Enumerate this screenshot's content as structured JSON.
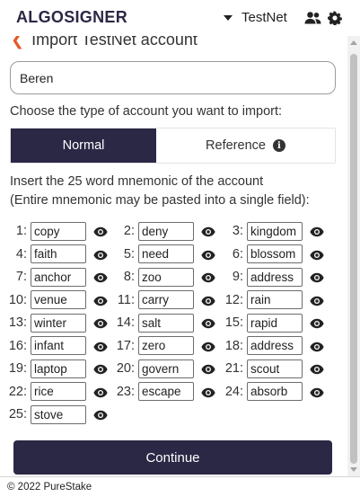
{
  "header": {
    "logo_text": "ALGOSIGNER",
    "network": "TestNet",
    "accounts_icon": "users-icon",
    "settings_icon": "gear-icon"
  },
  "page": {
    "back_icon": "chevron-left-icon",
    "title": "Import TestNet account"
  },
  "form": {
    "account_name_value": "Beren",
    "choose_label": "Choose the type of account you want to import:",
    "types": [
      {
        "label": "Normal",
        "selected": true
      },
      {
        "label": "Reference",
        "selected": false,
        "icon": "info-icon"
      }
    ],
    "instruction_line1": "Insert the 25 word mnemonic of the account",
    "instruction_line2": "(Entire mnemonic may be pasted into a single field):",
    "mnemonic": [
      {
        "n": "1:",
        "w": "copy"
      },
      {
        "n": "2:",
        "w": "deny"
      },
      {
        "n": "3:",
        "w": "kingdom"
      },
      {
        "n": "4:",
        "w": "faith"
      },
      {
        "n": "5:",
        "w": "need"
      },
      {
        "n": "6:",
        "w": "blossom"
      },
      {
        "n": "7:",
        "w": "anchor"
      },
      {
        "n": "8:",
        "w": "zoo"
      },
      {
        "n": "9:",
        "w": "address"
      },
      {
        "n": "10:",
        "w": "venue"
      },
      {
        "n": "11:",
        "w": "carry"
      },
      {
        "n": "12:",
        "w": "rain"
      },
      {
        "n": "13:",
        "w": "winter"
      },
      {
        "n": "14:",
        "w": "salt"
      },
      {
        "n": "15:",
        "w": "rapid"
      },
      {
        "n": "16:",
        "w": "infant"
      },
      {
        "n": "17:",
        "w": "zero"
      },
      {
        "n": "18:",
        "w": "address"
      },
      {
        "n": "19:",
        "w": "laptop"
      },
      {
        "n": "20:",
        "w": "govern"
      },
      {
        "n": "21:",
        "w": "scout"
      },
      {
        "n": "22:",
        "w": "rice"
      },
      {
        "n": "23:",
        "w": "escape"
      },
      {
        "n": "24:",
        "w": "absorb"
      },
      {
        "n": "25:",
        "w": "stove"
      }
    ],
    "word_icon": "eye-icon",
    "continue_label": "Continue"
  },
  "footer": {
    "copyright": "© 2022 PureStake"
  },
  "colors": {
    "brand_dark": "#2b2845",
    "brand_accent": "#e45a2b"
  }
}
